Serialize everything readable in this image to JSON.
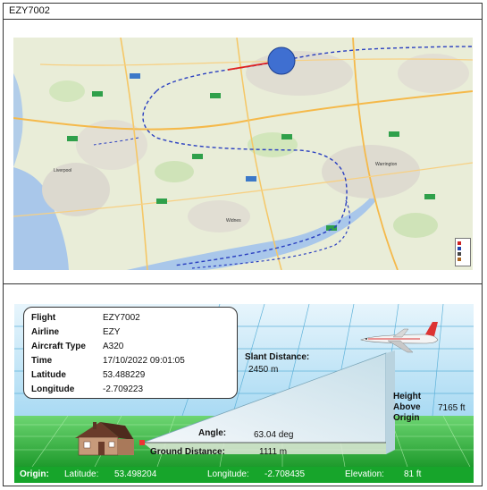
{
  "window": {
    "title": "EZY7002"
  },
  "map": {
    "places": [
      "Liverpool",
      "Widnes",
      "Warrington"
    ]
  },
  "info": {
    "rows": [
      {
        "label": "Flight",
        "value": "EZY7002"
      },
      {
        "label": "Airline",
        "value": "EZY"
      },
      {
        "label": "Aircraft Type",
        "value": "A320"
      },
      {
        "label": "Time",
        "value": "17/10/2022 09:01:05"
      },
      {
        "label": "Latitude",
        "value": "53.488229"
      },
      {
        "label": "Longitude",
        "value": "-2.709223"
      }
    ]
  },
  "geometry": {
    "slant_label": "Slant Distance:",
    "slant_value": "2450 m",
    "height_label_1": "Height",
    "height_label_2": "Above",
    "height_label_3": "Origin",
    "height_value": "7165 ft",
    "angle_label": "Angle:",
    "angle_value": "63.04 deg",
    "ground_label": "Ground Distance:",
    "ground_value": "1111 m"
  },
  "origin": {
    "label": "Origin:",
    "latitude_label": "Latitude:",
    "latitude_value": "53.498204",
    "longitude_label": "Longitude:",
    "longitude_value": "-2.708435",
    "elevation_label": "Elevation:",
    "elevation_value": "81 ft"
  },
  "colors": {
    "track": "#2a3fc0",
    "current_segment": "#e02020",
    "aircraft_marker": "#3f6fd1",
    "origin_bar": "#17a52b",
    "sky": "#bde3f5",
    "ground": "#2fae3d"
  }
}
